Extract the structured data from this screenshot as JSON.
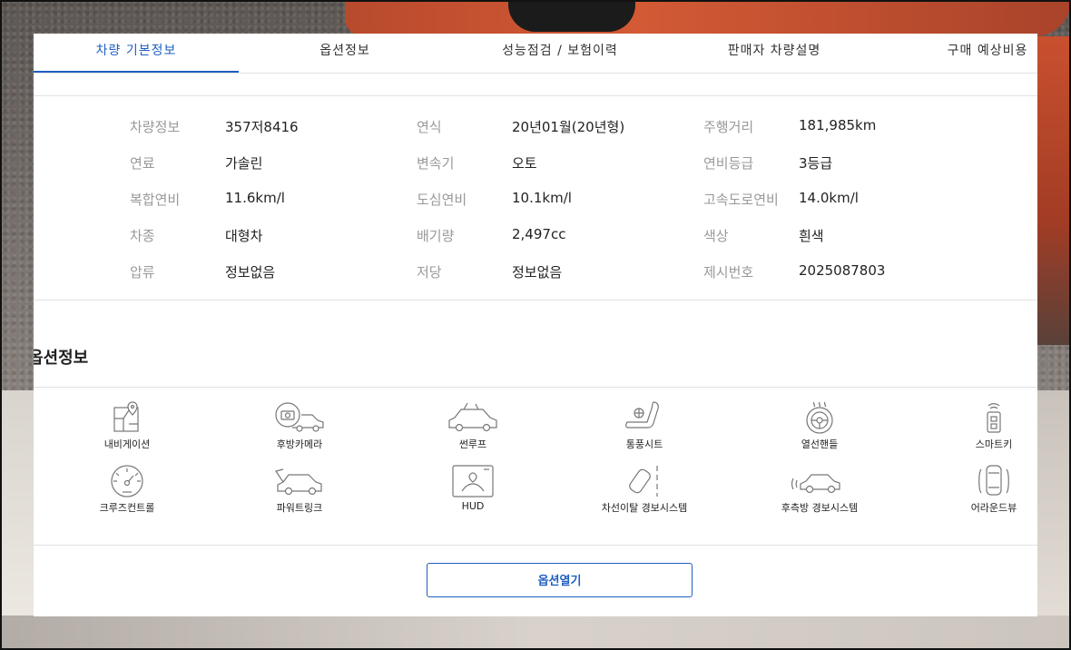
{
  "tabs": [
    {
      "label": "차량 기본정보",
      "active": true
    },
    {
      "label": "옵션정보",
      "active": false
    },
    {
      "label": "성능점검 / 보험이력",
      "active": false
    },
    {
      "label": "판매자 차량설명",
      "active": false
    },
    {
      "label": "구매 예상비용",
      "active": false
    }
  ],
  "specs": [
    [
      {
        "label": "차량정보",
        "value": "357저8416"
      },
      {
        "label": "연식",
        "value": "20년01월(20년형)"
      },
      {
        "label": "주행거리",
        "value": "181,985km"
      }
    ],
    [
      {
        "label": "연료",
        "value": "가솔린"
      },
      {
        "label": "변속기",
        "value": "오토"
      },
      {
        "label": "연비등급",
        "value": "3등급"
      }
    ],
    [
      {
        "label": "복합연비",
        "value": "11.6km/l"
      },
      {
        "label": "도심연비",
        "value": "10.1km/l"
      },
      {
        "label": "고속도로연비",
        "value": "14.0km/l"
      }
    ],
    [
      {
        "label": "차종",
        "value": "대형차"
      },
      {
        "label": "배기량",
        "value": "2,497cc"
      },
      {
        "label": "색상",
        "value": "흰색"
      }
    ],
    [
      {
        "label": "압류",
        "value": "정보없음"
      },
      {
        "label": "저당",
        "value": "정보없음"
      },
      {
        "label": "제시번호",
        "value": "2025087803"
      }
    ]
  ],
  "options_section": {
    "title": "옵션정보",
    "items": [
      {
        "label": "내비게이션",
        "icon": "navigation-icon"
      },
      {
        "label": "후방카메라",
        "icon": "rear-camera-icon"
      },
      {
        "label": "썬루프",
        "icon": "sunroof-icon"
      },
      {
        "label": "통풍시트",
        "icon": "ventilated-seat-icon"
      },
      {
        "label": "열선핸들",
        "icon": "heated-steering-icon"
      },
      {
        "label": "스마트키",
        "icon": "smart-key-icon"
      },
      {
        "label": "크루즈컨트롤",
        "icon": "cruise-control-icon"
      },
      {
        "label": "파워트링크",
        "icon": "power-trunk-icon"
      },
      {
        "label": "HUD",
        "icon": "hud-icon"
      },
      {
        "label": "차선이탈 경보시스템",
        "icon": "lane-departure-icon"
      },
      {
        "label": "후측방 경보시스템",
        "icon": "blind-spot-icon"
      },
      {
        "label": "어라운드뷰",
        "icon": "around-view-icon"
      }
    ]
  },
  "buttons": {
    "open_options": "옵션열기"
  },
  "colors": {
    "accent": "#1f5fc1",
    "label_gray": "#999999",
    "text": "#222222"
  }
}
